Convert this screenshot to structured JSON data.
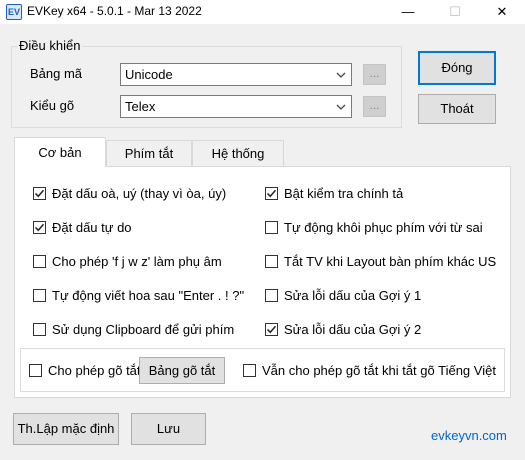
{
  "window": {
    "title": "EVKey x64 - 5.0.1 - Mar 13 2022",
    "icon": "ev-icon",
    "buttons": [
      "minimize",
      "maximize",
      "close"
    ],
    "minimize_glyph": "—",
    "maximize_glyph": "☐",
    "close_glyph": "✕"
  },
  "controls": {
    "legend": "Điều khiển",
    "charset_label": "Bảng mã",
    "charset_value": "Unicode",
    "method_label": "Kiểu gõ",
    "method_value": "Telex",
    "more_label": "...",
    "close_button": "Đóng",
    "exit_button": "Thoát"
  },
  "tabs": [
    {
      "label": "Cơ bản",
      "active": true
    },
    {
      "label": "Phím tắt",
      "active": false
    },
    {
      "label": "Hệ thống",
      "active": false
    }
  ],
  "options_left": [
    {
      "label": "Đặt dấu oà, uý (thay vì òa, úy)",
      "checked": true
    },
    {
      "label": "Đặt dấu tự do",
      "checked": true
    },
    {
      "label": "Cho phép 'f j w z' làm phụ âm",
      "checked": false
    },
    {
      "label": "Tự động viết hoa sau \"Enter . ! ?\"",
      "checked": false
    },
    {
      "label": "Sử dụng Clipboard để gửi phím",
      "checked": false
    }
  ],
  "options_right": [
    {
      "label": "Bật kiểm tra chính tả",
      "checked": true
    },
    {
      "label": "Tự động khôi phục phím với từ sai",
      "checked": false
    },
    {
      "label": "Tắt TV khi Layout bàn phím khác US",
      "checked": false
    },
    {
      "label": "Sửa lỗi dấu của Gợi ý 1",
      "checked": false
    },
    {
      "label": "Sửa lỗi dấu của Gợi ý 2",
      "checked": true
    }
  ],
  "shortcut_box": {
    "allow_label": "Cho phép gõ tắt",
    "allow_checked": false,
    "table_button": "Bảng gõ tắt",
    "still_label": "Vẫn cho phép gõ tắt khi tắt gõ Tiếng Việt",
    "still_checked": false
  },
  "footer": {
    "default_button": "Th.Lập mặc định",
    "save_button": "Lưu",
    "link": "evkeyvn.com"
  },
  "colors": {
    "accent": "#0078d7",
    "link": "#0066cc"
  }
}
